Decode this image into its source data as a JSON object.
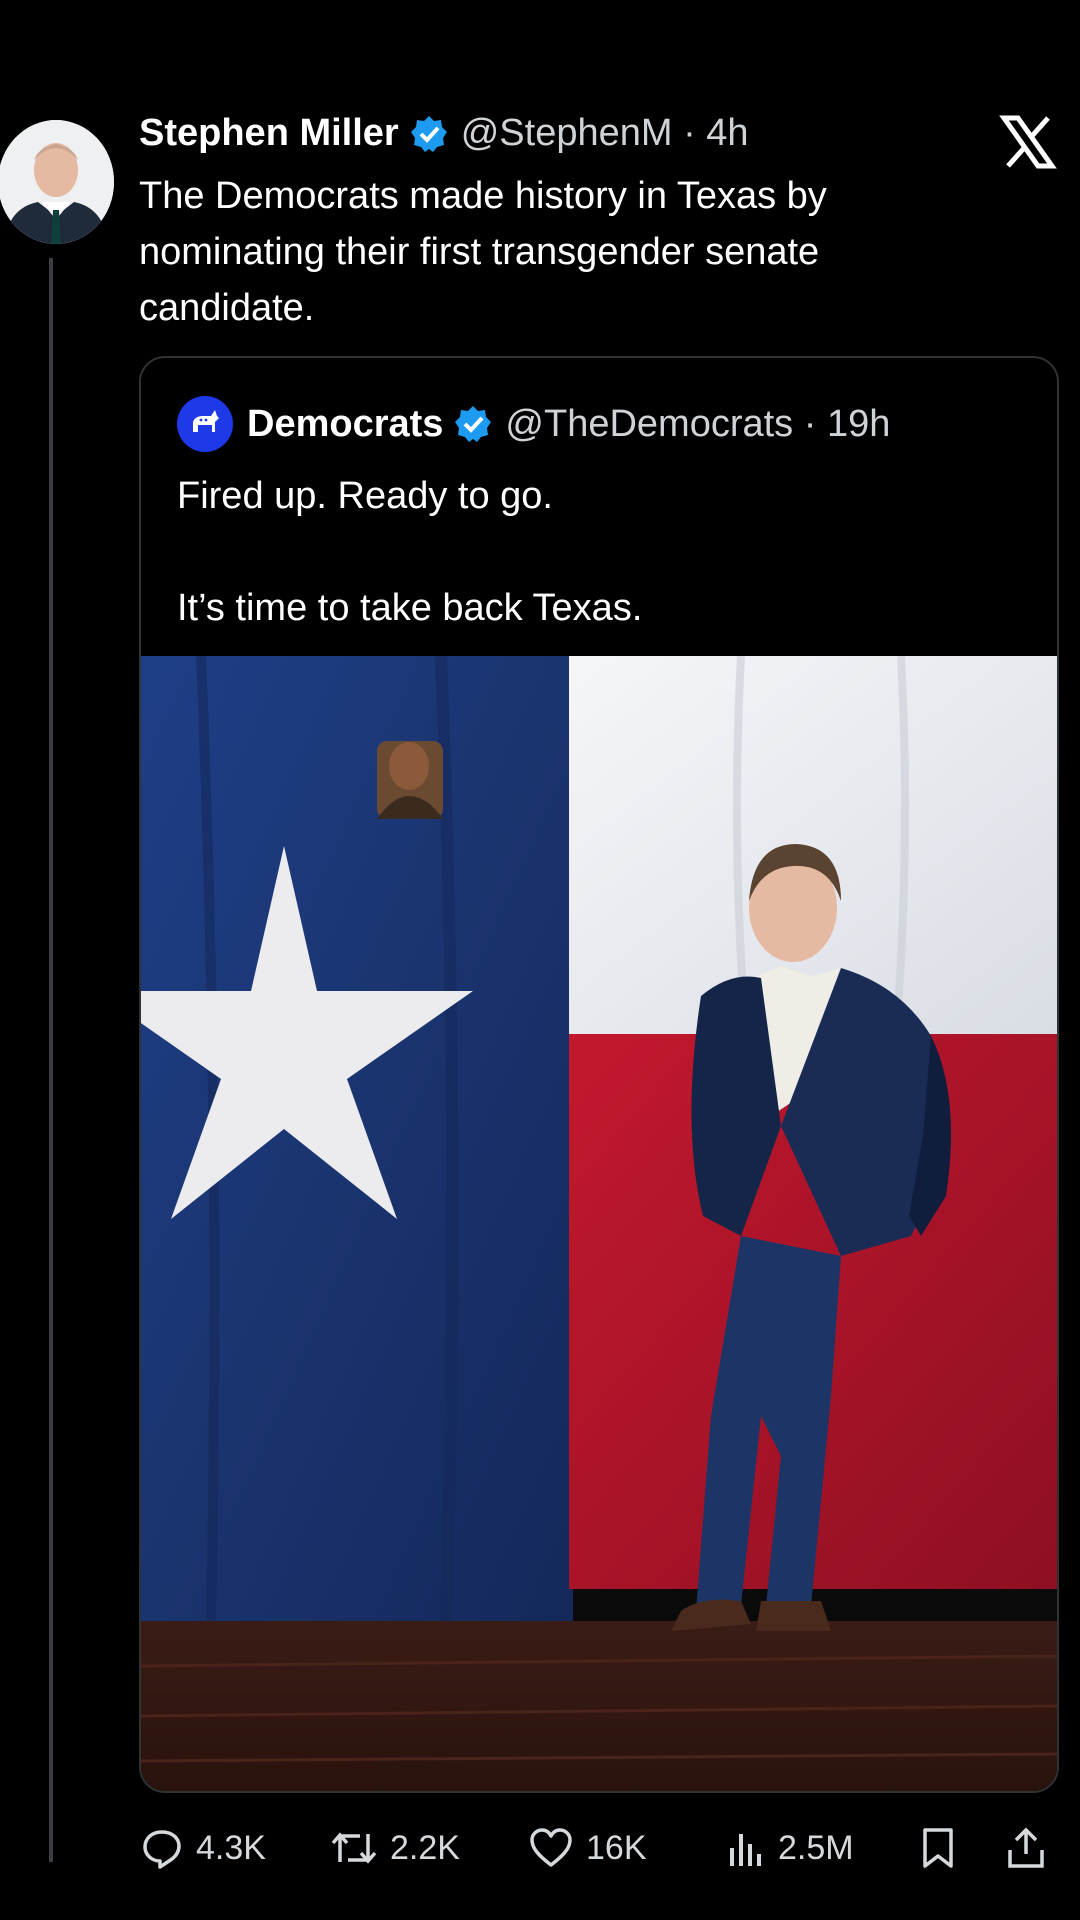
{
  "tweet": {
    "author_name": "Stephen Miller",
    "handle_time": "@StephenM · 4h",
    "text": "The Democrats made history in Texas by nominating their first transgender senate candidate."
  },
  "quote": {
    "author_name": "Democrats",
    "handle_time": "@TheDemocrats · 19h",
    "text": "Fired up. Ready to go.\n\nIt’s time to take back Texas."
  },
  "actions": {
    "replies": "4.3K",
    "reposts": "2.2K",
    "likes": "16K",
    "views": "2.5M"
  },
  "icons": {
    "close": "x-logo-icon",
    "reply": "reply-icon",
    "repost": "repost-icon",
    "like": "heart-icon",
    "views": "views-icon",
    "bookmark": "bookmark-icon",
    "share": "share-icon",
    "verified": "verified-badge-icon"
  },
  "colors": {
    "background": "#000000",
    "verified": "#1d9bf0",
    "flag_blue": "#1d3a7a",
    "flag_red": "#b3142a",
    "flag_white": "#eef0f4"
  }
}
